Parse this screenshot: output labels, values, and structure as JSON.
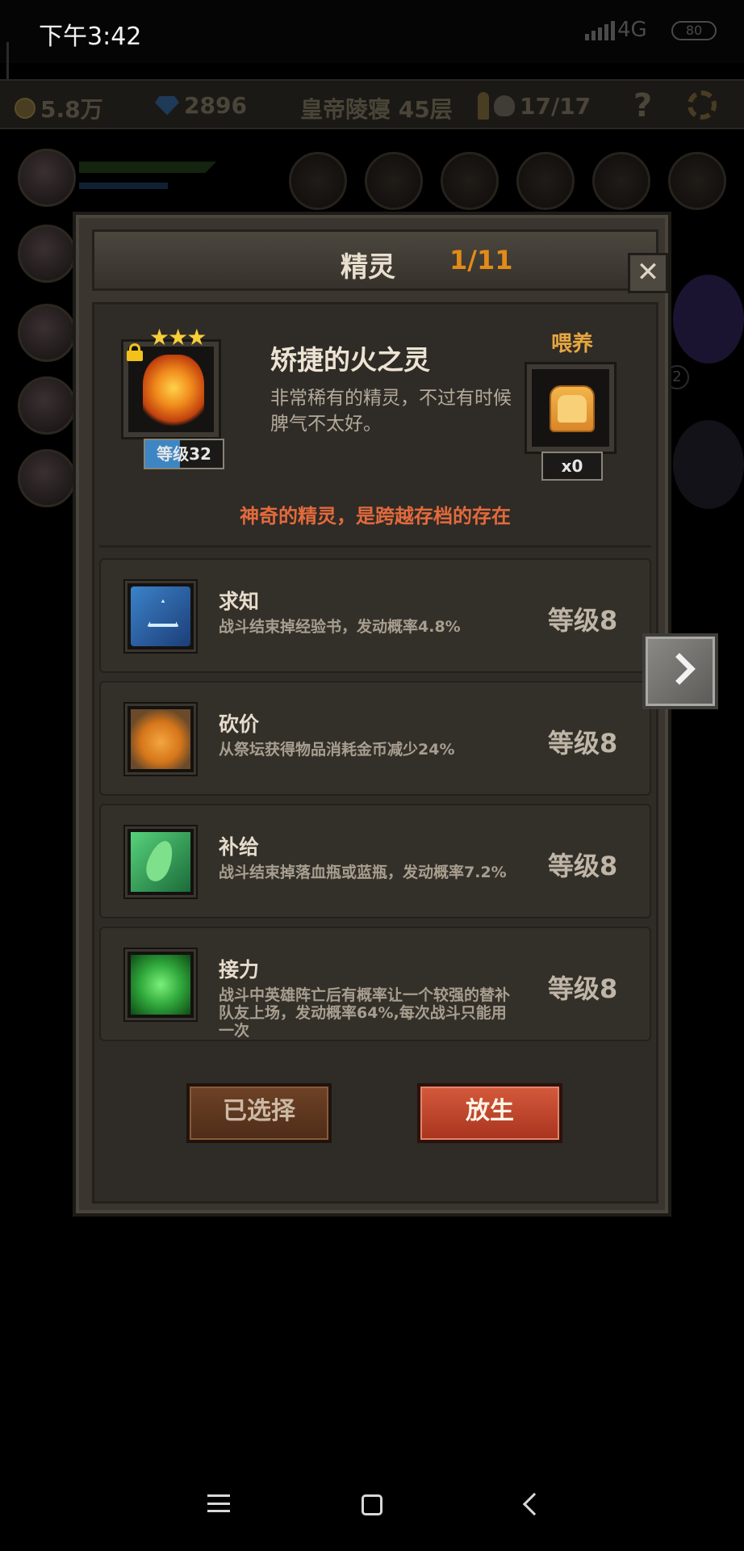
{
  "status_bar": {
    "time": "下午3:42",
    "network": "4G",
    "battery": "80"
  },
  "top_bar": {
    "gold": "5.8万",
    "gems": "2896",
    "location": "皇帝陵寝 45层",
    "kills": "17/17",
    "help": "?"
  },
  "background": {
    "badge": "2"
  },
  "dialog": {
    "title": "精灵",
    "count": "1/11",
    "close": "✕"
  },
  "spirit": {
    "stars": "★★★",
    "name": "矫捷的火之灵",
    "description": "非常稀有的精灵，不过有时候脾气不太好。",
    "level_label": "等级32",
    "level_progress": 0.45,
    "feed_label": "喂养",
    "feed_count": "x0",
    "tagline": "神奇的精灵，是跨越存档的存在"
  },
  "skills": [
    {
      "name": "求知",
      "description": "战斗结束掉经验书，发动概率4.8%",
      "level": "等级8",
      "icon": "book-icon"
    },
    {
      "name": "砍价",
      "description": "从祭坛获得物品消耗金币减少24%",
      "level": "等级8",
      "icon": "coins-icon"
    },
    {
      "name": "补给",
      "description": "战斗结束掉落血瓶或蓝瓶，发动概率7.2%",
      "level": "等级8",
      "icon": "leaf-icon"
    },
    {
      "name": "接力",
      "description": "战斗中英雄阵亡后有概率让一个较强的替补队友上场，发动概率64%,每次战斗只能用一次",
      "level": "等级8",
      "icon": "hands-icon"
    }
  ],
  "buttons": {
    "selected": "已选择",
    "release": "放生"
  },
  "colors": {
    "accent_orange": "#e38a18",
    "tagline_red": "#e36a3c",
    "release_red": "#c0442a",
    "level_blue": "#3d86c4",
    "star_gold": "#f7ce3a"
  }
}
